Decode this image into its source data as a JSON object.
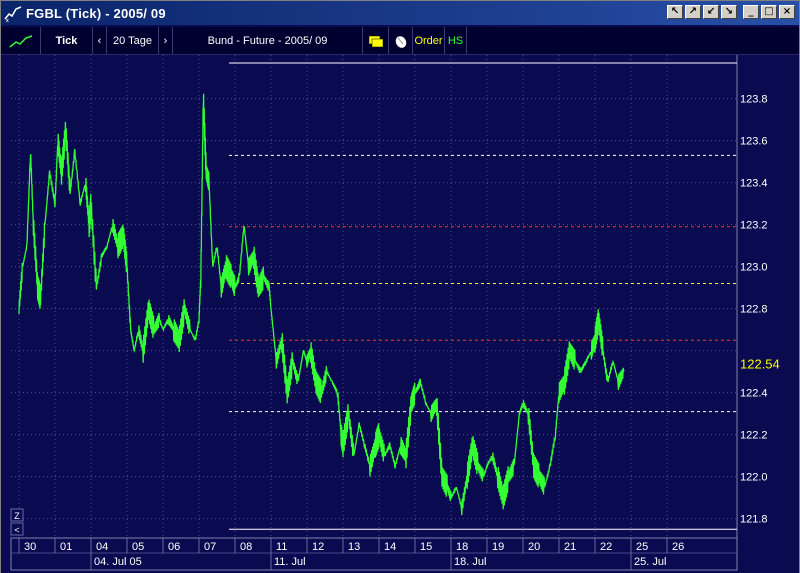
{
  "window": {
    "title": "FGBL  (Tick) - 2005/ 09",
    "buttons": [
      "↖",
      "↗",
      "↙",
      "↘",
      "_",
      "□",
      "×"
    ]
  },
  "toolbar": {
    "mode": "Tick",
    "prev": "‹",
    "range": "20 Tage",
    "next": "›",
    "instrument": "Bund - Future - 2005/ 09",
    "order": "Order",
    "hs": "HS"
  },
  "scroll_labels": {
    "zoom": "Z",
    "left": "<"
  },
  "colors": {
    "background": "#0a0a50",
    "price_line": "#33ff33",
    "last_price": "#ffff00"
  },
  "chart_data": {
    "type": "line",
    "ylim": [
      121.73,
      123.97
    ],
    "y_ticks": [
      121.8,
      122.0,
      122.2,
      122.4,
      122.6,
      122.8,
      123.0,
      123.2,
      123.4,
      123.6,
      123.8
    ],
    "y_tick_labels": [
      "121.8",
      "122.0",
      "122.2",
      "122.4",
      "",
      "122.8",
      "123.0",
      "123.2",
      "123.4",
      "123.6",
      "123.8"
    ],
    "last_price": 122.54,
    "last_price_label": "122.54",
    "x_day_labels": [
      "30",
      "01",
      "04",
      "05",
      "06",
      "07",
      "08",
      "11",
      "12",
      "13",
      "14",
      "15",
      "18",
      "19",
      "20",
      "21",
      "22",
      "25",
      "26"
    ],
    "x_week_labels": [
      {
        "label": "04. Jul 05",
        "day_index": 2
      },
      {
        "label": "11. Jul",
        "day_index": 7
      },
      {
        "label": "18. Jul",
        "day_index": 12
      },
      {
        "label": "25. Jul",
        "day_index": 17
      }
    ],
    "reference_lines": [
      {
        "value": 123.97,
        "color": "#ffffff",
        "style": "solid",
        "from_day": 5
      },
      {
        "value": 123.53,
        "color": "#ffffff",
        "style": "dashed",
        "from_day": 5
      },
      {
        "value": 123.19,
        "color": "#ff3030",
        "style": "dashed",
        "from_day": 5
      },
      {
        "value": 122.92,
        "color": "#ffff00",
        "style": "dashed",
        "from_day": 5
      },
      {
        "value": 122.65,
        "color": "#ff3030",
        "style": "dashed",
        "from_day": 5
      },
      {
        "value": 122.31,
        "color": "#ffffff",
        "style": "dashed",
        "from_day": 5
      },
      {
        "value": 121.75,
        "color": "#ffffff",
        "style": "solid",
        "from_day": 5
      }
    ],
    "series": [
      {
        "points": [
          [
            0.0,
            122.8
          ],
          [
            0.1,
            123.0
          ],
          [
            0.22,
            123.1
          ],
          [
            0.32,
            123.55
          ],
          [
            0.4,
            123.2
          ],
          [
            0.52,
            122.9
          ],
          [
            0.6,
            122.85
          ],
          [
            0.72,
            123.2
          ],
          [
            0.85,
            123.45
          ],
          [
            1.0,
            123.3
          ],
          [
            1.08,
            123.6
          ],
          [
            1.18,
            123.45
          ],
          [
            1.3,
            123.65
          ],
          [
            1.42,
            123.35
          ],
          [
            1.55,
            123.55
          ],
          [
            1.7,
            123.3
          ],
          [
            1.85,
            123.4
          ],
          [
            1.95,
            123.2
          ],
          [
            2.0,
            123.3
          ],
          [
            2.15,
            122.9
          ],
          [
            2.3,
            123.05
          ],
          [
            2.45,
            123.1
          ],
          [
            2.6,
            123.2
          ],
          [
            2.75,
            123.1
          ],
          [
            2.9,
            123.15
          ],
          [
            3.0,
            123.0
          ],
          [
            3.1,
            122.7
          ],
          [
            3.2,
            122.6
          ],
          [
            3.32,
            122.7
          ],
          [
            3.45,
            122.6
          ],
          [
            3.6,
            122.8
          ],
          [
            3.75,
            122.7
          ],
          [
            3.9,
            122.75
          ],
          [
            4.0,
            122.7
          ],
          [
            4.15,
            122.75
          ],
          [
            4.3,
            122.7
          ],
          [
            4.45,
            122.65
          ],
          [
            4.6,
            122.8
          ],
          [
            4.75,
            122.7
          ],
          [
            4.9,
            122.65
          ],
          [
            5.0,
            122.75
          ],
          [
            5.05,
            122.95
          ],
          [
            5.12,
            123.8
          ],
          [
            5.2,
            123.45
          ],
          [
            5.28,
            123.4
          ],
          [
            5.38,
            123.0
          ],
          [
            5.5,
            123.1
          ],
          [
            5.62,
            122.9
          ],
          [
            5.75,
            123.0
          ],
          [
            5.9,
            122.95
          ],
          [
            6.0,
            122.9
          ],
          [
            6.12,
            122.95
          ],
          [
            6.25,
            123.2
          ],
          [
            6.38,
            123.0
          ],
          [
            6.52,
            123.05
          ],
          [
            6.65,
            122.9
          ],
          [
            6.8,
            122.95
          ],
          [
            6.95,
            122.9
          ],
          [
            7.0,
            122.8
          ],
          [
            7.15,
            122.55
          ],
          [
            7.3,
            122.65
          ],
          [
            7.45,
            122.4
          ],
          [
            7.6,
            122.55
          ],
          [
            7.75,
            122.45
          ],
          [
            7.9,
            122.6
          ],
          [
            8.0,
            122.55
          ],
          [
            8.1,
            122.6
          ],
          [
            8.25,
            122.45
          ],
          [
            8.4,
            122.4
          ],
          [
            8.55,
            122.5
          ],
          [
            8.7,
            122.45
          ],
          [
            8.85,
            122.4
          ],
          [
            8.95,
            122.2
          ],
          [
            9.0,
            122.15
          ],
          [
            9.15,
            122.3
          ],
          [
            9.3,
            122.1
          ],
          [
            9.45,
            122.25
          ],
          [
            9.6,
            122.15
          ],
          [
            9.75,
            122.05
          ],
          [
            9.9,
            122.15
          ],
          [
            10.0,
            122.2
          ],
          [
            10.15,
            122.1
          ],
          [
            10.3,
            122.15
          ],
          [
            10.45,
            122.05
          ],
          [
            10.6,
            122.15
          ],
          [
            10.75,
            122.1
          ],
          [
            10.9,
            122.35
          ],
          [
            11.0,
            122.4
          ],
          [
            11.15,
            122.45
          ],
          [
            11.3,
            122.35
          ],
          [
            11.45,
            122.3
          ],
          [
            11.6,
            122.35
          ],
          [
            11.75,
            122.0
          ],
          [
            11.9,
            121.95
          ],
          [
            12.0,
            121.9
          ],
          [
            12.15,
            121.95
          ],
          [
            12.3,
            121.85
          ],
          [
            12.45,
            122.0
          ],
          [
            12.6,
            122.15
          ],
          [
            12.75,
            122.05
          ],
          [
            12.9,
            122.0
          ],
          [
            13.0,
            122.05
          ],
          [
            13.15,
            122.1
          ],
          [
            13.3,
            122.0
          ],
          [
            13.45,
            121.9
          ],
          [
            13.6,
            122.0
          ],
          [
            13.75,
            122.05
          ],
          [
            13.9,
            122.3
          ],
          [
            14.0,
            122.35
          ],
          [
            14.15,
            122.3
          ],
          [
            14.3,
            122.05
          ],
          [
            14.45,
            122.0
          ],
          [
            14.6,
            121.95
          ],
          [
            14.75,
            122.05
          ],
          [
            14.9,
            122.2
          ],
          [
            15.0,
            122.4
          ],
          [
            15.15,
            122.45
          ],
          [
            15.3,
            122.6
          ],
          [
            15.45,
            122.55
          ],
          [
            15.6,
            122.5
          ],
          [
            15.75,
            122.55
          ],
          [
            15.9,
            122.6
          ],
          [
            16.0,
            122.65
          ],
          [
            16.1,
            122.75
          ],
          [
            16.22,
            122.6
          ],
          [
            16.35,
            122.45
          ],
          [
            16.5,
            122.55
          ],
          [
            16.65,
            122.45
          ],
          [
            16.8,
            122.5
          ]
        ]
      }
    ]
  }
}
